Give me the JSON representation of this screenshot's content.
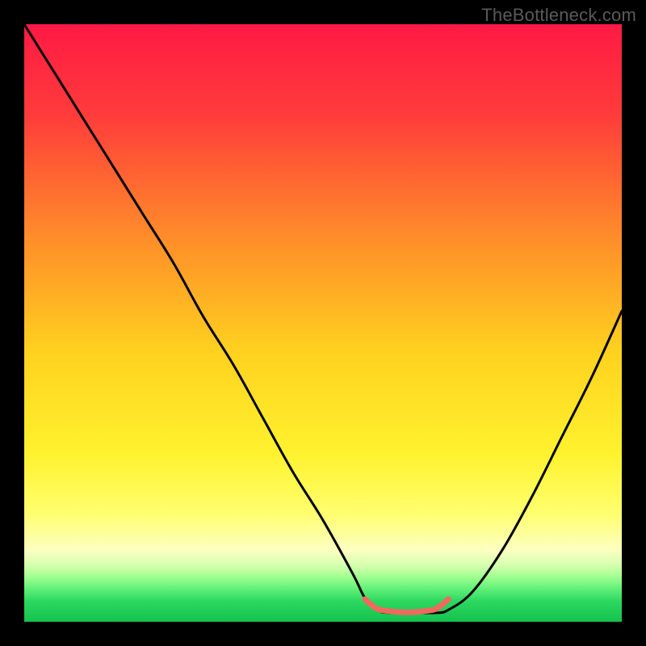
{
  "watermark": "TheBottleneck.com",
  "chart_data": {
    "type": "line",
    "title": "",
    "xlabel": "",
    "ylabel": "",
    "xlim": [
      0,
      100
    ],
    "ylim": [
      0,
      100
    ],
    "grid": false,
    "legend": false,
    "gradient_stops": [
      {
        "offset": 0.0,
        "color": "#ff1a44"
      },
      {
        "offset": 0.15,
        "color": "#ff3b3b"
      },
      {
        "offset": 0.35,
        "color": "#ff8a2a"
      },
      {
        "offset": 0.55,
        "color": "#ffd21f"
      },
      {
        "offset": 0.72,
        "color": "#fff22e"
      },
      {
        "offset": 0.82,
        "color": "#ffff70"
      },
      {
        "offset": 0.88,
        "color": "#fcffc0"
      },
      {
        "offset": 0.905,
        "color": "#d6ffb0"
      },
      {
        "offset": 0.925,
        "color": "#a0ff90"
      },
      {
        "offset": 0.945,
        "color": "#60f078"
      },
      {
        "offset": 0.965,
        "color": "#2ed860"
      },
      {
        "offset": 1.0,
        "color": "#14c24e"
      }
    ],
    "series": [
      {
        "name": "bottleneck-curve",
        "color": "#000000",
        "x": [
          0,
          5,
          10,
          15,
          20,
          25,
          30,
          35,
          40,
          45,
          50,
          55,
          57,
          59,
          61,
          65,
          69,
          71,
          75,
          80,
          85,
          90,
          95,
          100
        ],
        "y": [
          100,
          92,
          84,
          76,
          68,
          60,
          51,
          43,
          34,
          25,
          17,
          8,
          4,
          2,
          1.5,
          1.5,
          1.5,
          2,
          5,
          12,
          21,
          31,
          41,
          52
        ]
      },
      {
        "name": "optimal-band",
        "color": "#ef6a5e",
        "stroke_width": 7,
        "x": [
          57,
          59,
          61,
          63,
          65,
          67,
          69,
          71
        ],
        "y": [
          3.8,
          2.2,
          1.8,
          1.6,
          1.6,
          1.8,
          2.2,
          3.8
        ]
      }
    ],
    "annotations": []
  }
}
